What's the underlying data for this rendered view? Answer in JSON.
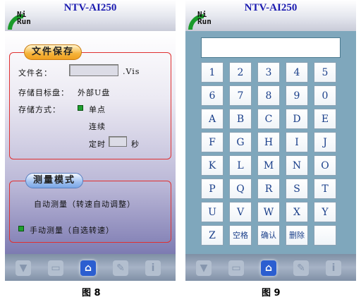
{
  "screen8": {
    "header": {
      "title": "NTV-AI250",
      "logo": "Ni\nRun"
    },
    "save_section": {
      "title": "文件保存",
      "filename_label": "文件名：",
      "filename_value": "",
      "filename_ext": ".Vis",
      "target_label": "存储目标盘：",
      "target_value": "外部U盘",
      "mode_label": "存储方式：",
      "option_single": "单点",
      "option_continuous": "连续",
      "option_timed": "定时",
      "timed_value": "",
      "timed_unit": "秒"
    },
    "measure_section": {
      "title": "测量模式",
      "option_auto": "自动测量（转速自动调整）",
      "option_manual": "手动测量（自选转速）"
    },
    "caption": "图 8"
  },
  "screen9": {
    "header": {
      "title": "NTV-AI250",
      "logo": "Ni\nRun"
    },
    "display_value": "",
    "keys": [
      "1",
      "2",
      "3",
      "4",
      "5",
      "6",
      "7",
      "8",
      "9",
      "0",
      "A",
      "B",
      "C",
      "D",
      "E",
      "F",
      "G",
      "H",
      "I",
      "J",
      "K",
      "L",
      "M",
      "N",
      "O",
      "P",
      "Q",
      "R",
      "S",
      "T",
      "U",
      "V",
      "W",
      "X",
      "Y",
      "Z",
      "空格",
      "确认",
      "删除",
      ""
    ],
    "caption": "图 9"
  },
  "toolbar": {
    "icons": [
      "shirt-icon",
      "monitor-icon",
      "home-icon",
      "wrench-icon",
      "info-icon"
    ],
    "active": "home-icon"
  }
}
